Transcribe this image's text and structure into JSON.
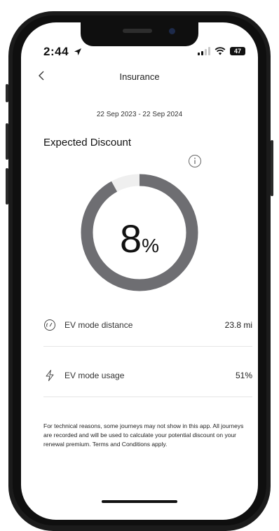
{
  "status_bar": {
    "time": "2:44",
    "battery": "47"
  },
  "header": {
    "title": "Insurance"
  },
  "period": {
    "date_range": "22 Sep 2023 - 22 Sep 2024"
  },
  "discount": {
    "heading": "Expected Discount",
    "value": "8",
    "unit": "%",
    "fraction": 0.92
  },
  "metrics": [
    {
      "label": "EV mode distance",
      "value": "23.8 mi",
      "icon": "gauge-icon"
    },
    {
      "label": "EV mode usage",
      "value": "51%",
      "icon": "lightning-icon"
    }
  ],
  "note": "For technical reasons, some journeys may not show in this app. All journeys are recorded and will be used to calculate your potential discount on your renewal premium. Terms and Conditions apply.",
  "colors": {
    "ring": "#6e6e72",
    "ring_track": "#efefef"
  }
}
